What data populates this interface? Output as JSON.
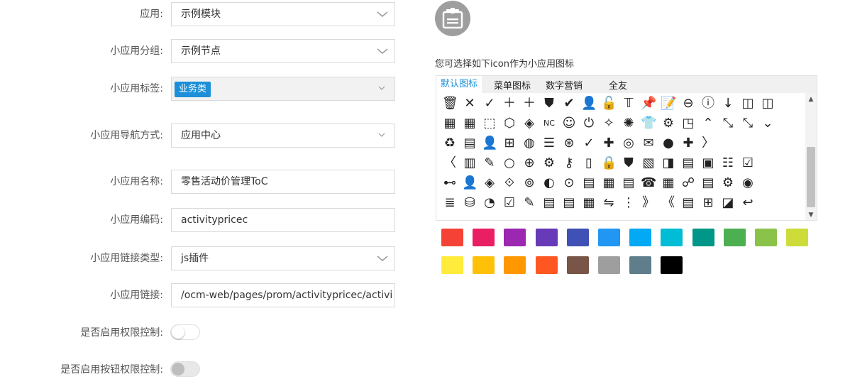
{
  "form": {
    "app": {
      "label": "应用:",
      "value": "示例模块"
    },
    "group": {
      "label": "小应用分组:",
      "value": "示例节点"
    },
    "tag": {
      "label": "小应用标签:",
      "value": "业务类"
    },
    "nav": {
      "label": "小应用导航方式:",
      "value": "应用中心"
    },
    "name": {
      "label": "小应用名称:",
      "value": "零售活动价管理ToC"
    },
    "code": {
      "label": "小应用编码:",
      "value": "activitypricec"
    },
    "link_type": {
      "label": "小应用链接类型:",
      "value": "js插件"
    },
    "link": {
      "label": "小应用链接:",
      "value": "/ocm-web/pages/prom/activitypricec/activi"
    },
    "perm": {
      "label": "是否启用权限控制:"
    },
    "btn_perm": {
      "label": "是否启用按钮权限控制:"
    }
  },
  "picker": {
    "hint": "您可选择如下icon作为小应用图标",
    "tabs": [
      "默认图标",
      "菜单图标",
      "数字营销",
      "全友"
    ],
    "rows": [
      [
        "🗑",
        "✕",
        "✓",
        "＋",
        "＋",
        "⛊",
        "✔",
        "👤",
        "🔓",
        "𝕋",
        "📌",
        "📝",
        "⊖",
        "ⓘ",
        "↓",
        "◫",
        "◫"
      ],
      [
        "▦",
        "▦",
        "⬚",
        "⬡",
        "◈",
        "NC",
        "☺",
        "⏻",
        "✧",
        "✺",
        "👕",
        "⚙",
        "◳",
        "⌃",
        "⤡",
        "⤡",
        "⌄"
      ],
      [
        "♻",
        "▤",
        "👤",
        "⊞",
        "◍",
        "☰",
        "⊛",
        "✓",
        "✚",
        "◎",
        "✉",
        "●",
        "✚",
        "〉"
      ],
      [
        "〈",
        "▥",
        "✎",
        "○",
        "⊕",
        "⚙",
        "⚷",
        "▯",
        "🔒",
        "⛊",
        "▧",
        "◨",
        "▤",
        "▣",
        "☷",
        "☑"
      ],
      [
        "⊷",
        "👤",
        "◈",
        "⟐",
        "⊚",
        "◐",
        "⊙",
        "▤",
        "▦",
        "▤",
        "☎",
        "▦",
        "☍",
        "▤",
        "⚙",
        "◉"
      ],
      [
        "≣",
        "⛁",
        "◔",
        "☑",
        "✎",
        "▤",
        "▤",
        "▦",
        "⇋",
        "⋮",
        "》",
        "《",
        "▤",
        "⊞",
        "◪",
        "↩"
      ]
    ],
    "colors": [
      "#f44336",
      "#e91e63",
      "#9c27b0",
      "#673ab7",
      "#3f51b5",
      "#2196f3",
      "#03a9f4",
      "#00bcd4",
      "#009688",
      "#4caf50",
      "#8bc34a",
      "#cddc39",
      "#ffeb3b",
      "#ffc107",
      "#ff9800",
      "#ff5722",
      "#795548",
      "#9e9e9e",
      "#607d8b",
      "#000000"
    ]
  }
}
